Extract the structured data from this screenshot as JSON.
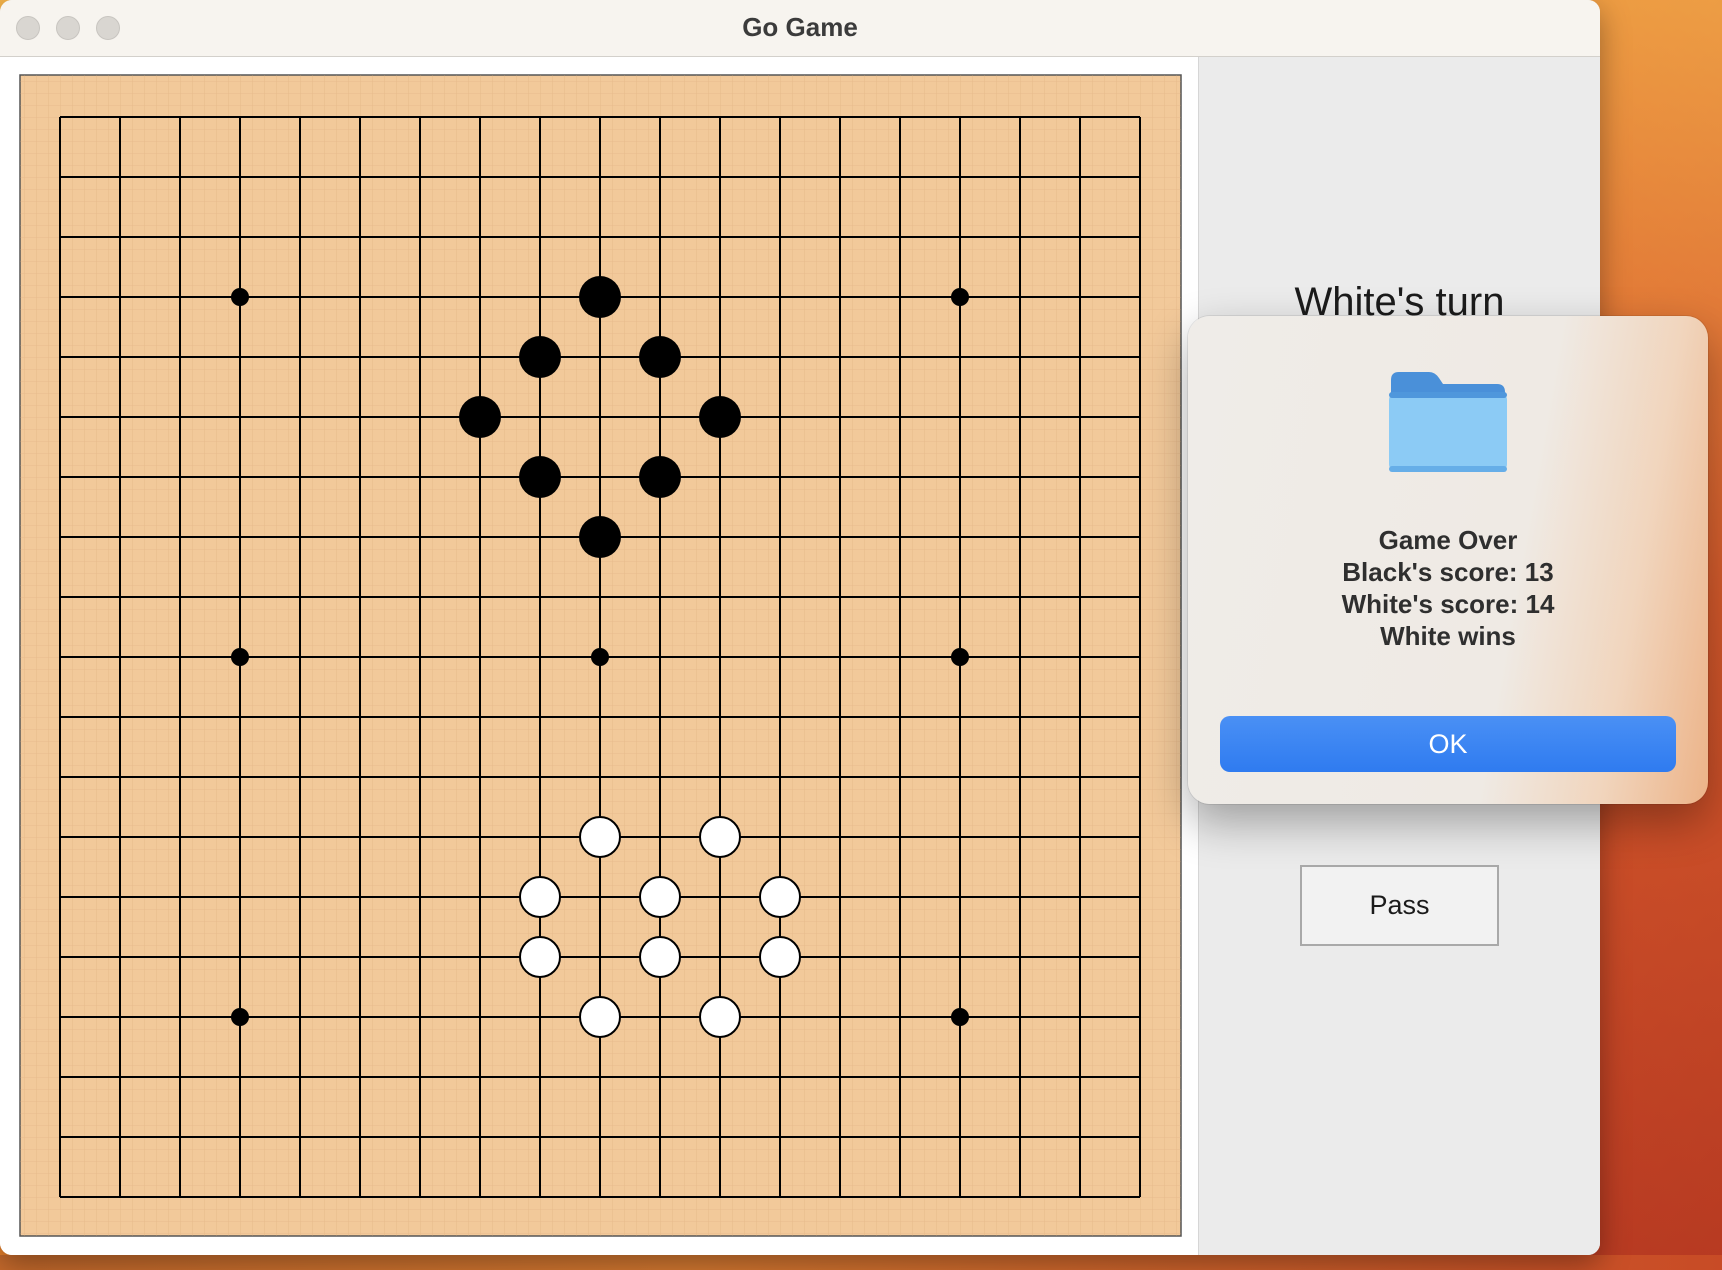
{
  "window": {
    "title": "Go Game"
  },
  "board": {
    "size": 19,
    "background_color": "#f2c99a",
    "line_color": "#000000",
    "star_points": [
      [
        3,
        3
      ],
      [
        15,
        3
      ],
      [
        3,
        9
      ],
      [
        9,
        9
      ],
      [
        15,
        9
      ],
      [
        3,
        15
      ],
      [
        15,
        15
      ]
    ],
    "black_stones": [
      [
        9,
        3
      ],
      [
        8,
        4
      ],
      [
        10,
        4
      ],
      [
        7,
        5
      ],
      [
        11,
        5
      ],
      [
        8,
        6
      ],
      [
        10,
        6
      ],
      [
        9,
        7
      ]
    ],
    "white_stones": [
      [
        9,
        12
      ],
      [
        11,
        12
      ],
      [
        8,
        13
      ],
      [
        10,
        13
      ],
      [
        12,
        13
      ],
      [
        8,
        14
      ],
      [
        10,
        14
      ],
      [
        12,
        14
      ],
      [
        9,
        15
      ],
      [
        11,
        15
      ]
    ]
  },
  "side_panel": {
    "turn_label": "White's turn",
    "pass_label": "Pass"
  },
  "dialog": {
    "icon": "folder-icon",
    "lines": [
      "Game Over",
      "Black's score: 13",
      "White's score: 14",
      "White wins"
    ],
    "ok_label": "OK",
    "accent_color": "#3580f2"
  }
}
